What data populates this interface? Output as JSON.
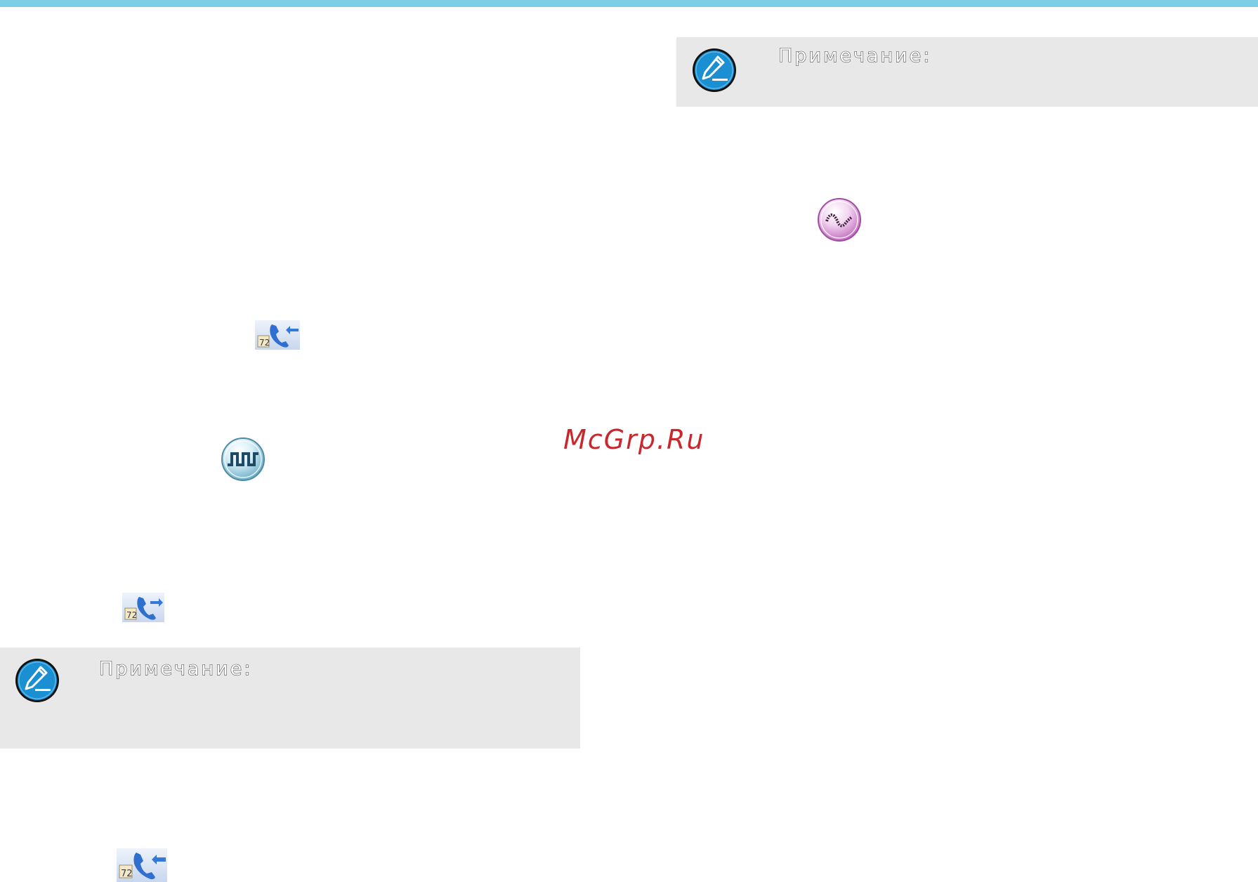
{
  "notes": {
    "right": {
      "label": "Примечание:"
    },
    "left": {
      "label": "Примечание:"
    }
  },
  "watermark": {
    "text": "McGrp.Ru"
  },
  "colors": {
    "top_bar": "#7ccfe4",
    "note_background": "#e7e8e7",
    "note_icon": "#1a8fd1",
    "watermark": "#c8272d"
  },
  "icons": [
    "incoming-call-icon",
    "digital-signal-icon",
    "outgoing-call-icon",
    "incoming-call-icon",
    "analog-signal-icon",
    "note-pencil-icon"
  ]
}
